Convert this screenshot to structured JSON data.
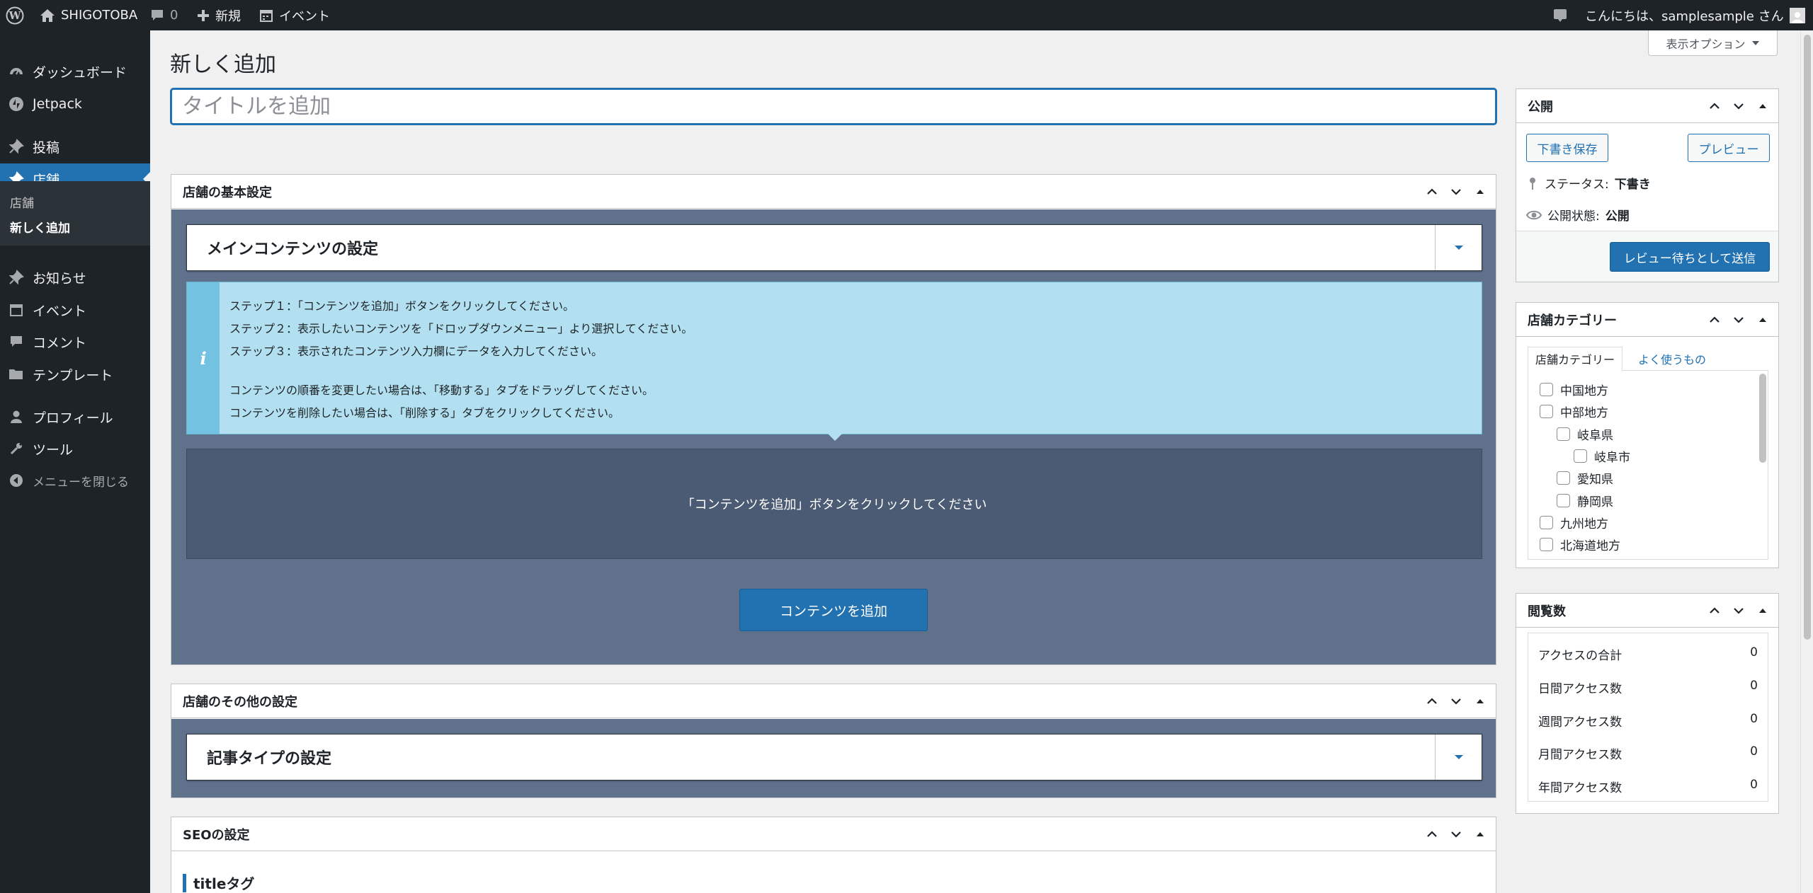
{
  "adminbar": {
    "site_name": "SHIGOTOBA",
    "comments_count": "0",
    "new_label": "新規",
    "event_label": "イベント",
    "greeting": "こんにちは、samplesample さん"
  },
  "sidebar": {
    "items": [
      {
        "label": "ダッシュボード",
        "icon": "dashboard-icon"
      },
      {
        "label": "Jetpack",
        "icon": "jetpack-icon"
      },
      {
        "label": "投稿",
        "icon": "pin-icon"
      },
      {
        "label": "店舗",
        "icon": "pin-icon"
      },
      {
        "label": "お知らせ",
        "icon": "pin-icon"
      },
      {
        "label": "イベント",
        "icon": "calendar-icon"
      },
      {
        "label": "コメント",
        "icon": "comment-icon"
      },
      {
        "label": "テンプレート",
        "icon": "folder-icon"
      },
      {
        "label": "プロフィール",
        "icon": "user-icon"
      },
      {
        "label": "ツール",
        "icon": "wrench-icon"
      },
      {
        "label": "メニューを閉じる",
        "icon": "collapse-icon"
      }
    ],
    "submenu": [
      "店舗",
      "新しく追加"
    ]
  },
  "page": {
    "title": "新しく追加",
    "screen_options": "表示オプション",
    "title_placeholder": "タイトルを追加"
  },
  "basic_settings": {
    "header": "店舗の基本設定",
    "accordion": "メインコンテンツの設定",
    "info_lines": [
      "ステップ１：「コンテンツを追加」ボタンをクリックしてください。",
      "ステップ２：表示したいコンテンツを「ドロップダウンメニュー」より選択してください。",
      "ステップ３：表示されたコンテンツ入力欄にデータを入力してください。",
      "コンテンツの順番を変更したい場合は、「移動する」タブをドラッグしてください。",
      "コンテンツを削除したい場合は、「削除する」タブをクリックしてください。"
    ],
    "info_icon": "i",
    "dropzone": "「コンテンツを追加」ボタンをクリックしてください",
    "add_button": "コンテンツを追加"
  },
  "other_settings": {
    "header": "店舗のその他の設定",
    "accordion": "記事タイプの設定"
  },
  "seo": {
    "header": "SEOの設定",
    "title_tag": "titleタグ"
  },
  "publish": {
    "header": "公開",
    "save_draft": "下書き保存",
    "preview": "プレビュー",
    "status_label": "ステータス:",
    "status_value": "下書き",
    "visibility_label": "公開状態:",
    "visibility_value": "公開",
    "submit": "レビュー待ちとして送信"
  },
  "categories": {
    "header": "店舗カテゴリー",
    "tabs": [
      "店舗カテゴリー",
      "よく使うもの"
    ],
    "items": [
      "中国地方",
      "中部地方",
      "岐阜県",
      "岐阜市",
      "愛知県",
      "静岡県",
      "九州地方",
      "北海道地方"
    ]
  },
  "views": {
    "header": "閲覧数",
    "rows": [
      {
        "label": "アクセスの合計",
        "value": "0"
      },
      {
        "label": "日間アクセス数",
        "value": "0"
      },
      {
        "label": "週間アクセス数",
        "value": "0"
      },
      {
        "label": "月間アクセス数",
        "value": "0"
      },
      {
        "label": "年間アクセス数",
        "value": "0"
      }
    ]
  },
  "colors": {
    "accent": "#2271b1",
    "adminbar": "#1d2327",
    "info_bg": "#b2e0f0",
    "metabox_blue": "#60718c"
  }
}
